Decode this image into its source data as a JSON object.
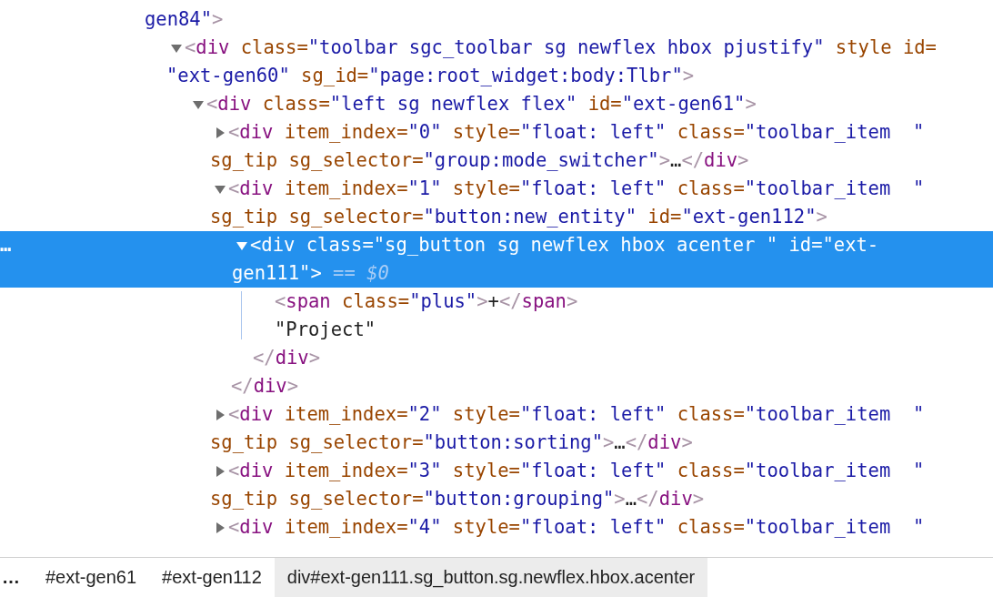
{
  "elements_tree": {
    "top_fragment": [
      {
        "kind": "value",
        "text": "gen84\""
      },
      {
        "kind": "punct",
        "text": ">"
      }
    ],
    "nodes": [
      {
        "kind": "element",
        "expanded": true,
        "selected": false,
        "lines": [
          [
            {
              "kind": "punct",
              "text": "<"
            },
            {
              "kind": "tag",
              "text": "div"
            },
            {
              "kind": "attr",
              "text": " class="
            },
            {
              "kind": "value",
              "text": "\"toolbar sgc_toolbar sg newflex hbox pjustify\""
            },
            {
              "kind": "attr",
              "text": " style id="
            }
          ],
          [
            {
              "kind": "value",
              "text": "\"ext-gen60\""
            },
            {
              "kind": "attr",
              "text": " sg_id="
            },
            {
              "kind": "value",
              "text": "\"page:root_widget:body:Tlbr\""
            },
            {
              "kind": "punct",
              "text": ">"
            }
          ]
        ],
        "children": [
          {
            "kind": "element",
            "expanded": true,
            "selected": false,
            "lines": [
              [
                {
                  "kind": "punct",
                  "text": "<"
                },
                {
                  "kind": "tag",
                  "text": "div"
                },
                {
                  "kind": "attr",
                  "text": " class="
                },
                {
                  "kind": "value",
                  "text": "\"left sg newflex flex\""
                },
                {
                  "kind": "attr",
                  "text": " id="
                },
                {
                  "kind": "value",
                  "text": "\"ext-gen61\""
                },
                {
                  "kind": "punct",
                  "text": ">"
                }
              ]
            ],
            "children": [
              {
                "kind": "element",
                "expanded": false,
                "selected": false,
                "lines": [
                  [
                    {
                      "kind": "punct",
                      "text": "<"
                    },
                    {
                      "kind": "tag",
                      "text": "div"
                    },
                    {
                      "kind": "attr",
                      "text": " item_index="
                    },
                    {
                      "kind": "value",
                      "text": "\"0\""
                    },
                    {
                      "kind": "attr",
                      "text": " style="
                    },
                    {
                      "kind": "value",
                      "text": "\"float: left\""
                    },
                    {
                      "kind": "attr",
                      "text": " class="
                    },
                    {
                      "kind": "value",
                      "text": "\"toolbar_item  \""
                    }
                  ],
                  [
                    {
                      "kind": "attr",
                      "text": "sg_tip sg_selector="
                    },
                    {
                      "kind": "value",
                      "text": "\"group:mode_switcher\""
                    },
                    {
                      "kind": "punct",
                      "text": ">"
                    },
                    {
                      "kind": "text",
                      "text": "…"
                    },
                    {
                      "kind": "punct",
                      "text": "</"
                    },
                    {
                      "kind": "tag",
                      "text": "div"
                    },
                    {
                      "kind": "punct",
                      "text": ">"
                    }
                  ]
                ]
              },
              {
                "kind": "element",
                "expanded": true,
                "selected": false,
                "lines": [
                  [
                    {
                      "kind": "punct",
                      "text": "<"
                    },
                    {
                      "kind": "tag",
                      "text": "div"
                    },
                    {
                      "kind": "attr",
                      "text": " item_index="
                    },
                    {
                      "kind": "value",
                      "text": "\"1\""
                    },
                    {
                      "kind": "attr",
                      "text": " style="
                    },
                    {
                      "kind": "value",
                      "text": "\"float: left\""
                    },
                    {
                      "kind": "attr",
                      "text": " class="
                    },
                    {
                      "kind": "value",
                      "text": "\"toolbar_item  \""
                    }
                  ],
                  [
                    {
                      "kind": "attr",
                      "text": "sg_tip sg_selector="
                    },
                    {
                      "kind": "value",
                      "text": "\"button:new_entity\""
                    },
                    {
                      "kind": "attr",
                      "text": " id="
                    },
                    {
                      "kind": "value",
                      "text": "\"ext-gen112\""
                    },
                    {
                      "kind": "punct",
                      "text": ">"
                    }
                  ]
                ],
                "children": [
                  {
                    "kind": "element",
                    "expanded": true,
                    "selected": true,
                    "gutter": "…",
                    "lines": [
                      [
                        {
                          "kind": "punct",
                          "text": "<"
                        },
                        {
                          "kind": "tag",
                          "text": "div"
                        },
                        {
                          "kind": "attr",
                          "text": " class="
                        },
                        {
                          "kind": "value",
                          "text": "\"sg_button sg newflex hbox acenter \""
                        },
                        {
                          "kind": "attr",
                          "text": " id="
                        },
                        {
                          "kind": "value",
                          "text": "\"ext-"
                        }
                      ],
                      [
                        {
                          "kind": "value",
                          "text": "gen111\""
                        },
                        {
                          "kind": "punct",
                          "text": ">"
                        },
                        {
                          "kind": "ref",
                          "text": " == "
                        },
                        {
                          "kind": "refvar",
                          "text": "$0"
                        }
                      ]
                    ],
                    "children": [
                      {
                        "kind": "leaf",
                        "selected": false,
                        "lines": [
                          [
                            {
                              "kind": "punct",
                              "text": "<"
                            },
                            {
                              "kind": "tag",
                              "text": "span"
                            },
                            {
                              "kind": "attr",
                              "text": " class="
                            },
                            {
                              "kind": "value",
                              "text": "\"plus\""
                            },
                            {
                              "kind": "punct",
                              "text": ">"
                            },
                            {
                              "kind": "text",
                              "text": "+"
                            },
                            {
                              "kind": "punct",
                              "text": "</"
                            },
                            {
                              "kind": "tag",
                              "text": "span"
                            },
                            {
                              "kind": "punct",
                              "text": ">"
                            }
                          ]
                        ]
                      },
                      {
                        "kind": "leaf",
                        "selected": false,
                        "lines": [
                          [
                            {
                              "kind": "text",
                              "text": "\"Project\""
                            }
                          ]
                        ]
                      }
                    ],
                    "closing": [
                      {
                        "kind": "punct",
                        "text": "</"
                      },
                      {
                        "kind": "tag",
                        "text": "div"
                      },
                      {
                        "kind": "punct",
                        "text": ">"
                      }
                    ]
                  }
                ],
                "closing": [
                  {
                    "kind": "punct",
                    "text": "</"
                  },
                  {
                    "kind": "tag",
                    "text": "div"
                  },
                  {
                    "kind": "punct",
                    "text": ">"
                  }
                ]
              },
              {
                "kind": "element",
                "expanded": false,
                "selected": false,
                "lines": [
                  [
                    {
                      "kind": "punct",
                      "text": "<"
                    },
                    {
                      "kind": "tag",
                      "text": "div"
                    },
                    {
                      "kind": "attr",
                      "text": " item_index="
                    },
                    {
                      "kind": "value",
                      "text": "\"2\""
                    },
                    {
                      "kind": "attr",
                      "text": " style="
                    },
                    {
                      "kind": "value",
                      "text": "\"float: left\""
                    },
                    {
                      "kind": "attr",
                      "text": " class="
                    },
                    {
                      "kind": "value",
                      "text": "\"toolbar_item  \""
                    }
                  ],
                  [
                    {
                      "kind": "attr",
                      "text": "sg_tip sg_selector="
                    },
                    {
                      "kind": "value",
                      "text": "\"button:sorting\""
                    },
                    {
                      "kind": "punct",
                      "text": ">"
                    },
                    {
                      "kind": "text",
                      "text": "…"
                    },
                    {
                      "kind": "punct",
                      "text": "</"
                    },
                    {
                      "kind": "tag",
                      "text": "div"
                    },
                    {
                      "kind": "punct",
                      "text": ">"
                    }
                  ]
                ]
              },
              {
                "kind": "element",
                "expanded": false,
                "selected": false,
                "lines": [
                  [
                    {
                      "kind": "punct",
                      "text": "<"
                    },
                    {
                      "kind": "tag",
                      "text": "div"
                    },
                    {
                      "kind": "attr",
                      "text": " item_index="
                    },
                    {
                      "kind": "value",
                      "text": "\"3\""
                    },
                    {
                      "kind": "attr",
                      "text": " style="
                    },
                    {
                      "kind": "value",
                      "text": "\"float: left\""
                    },
                    {
                      "kind": "attr",
                      "text": " class="
                    },
                    {
                      "kind": "value",
                      "text": "\"toolbar_item  \""
                    }
                  ],
                  [
                    {
                      "kind": "attr",
                      "text": "sg_tip sg_selector="
                    },
                    {
                      "kind": "value",
                      "text": "\"button:grouping\""
                    },
                    {
                      "kind": "punct",
                      "text": ">"
                    },
                    {
                      "kind": "text",
                      "text": "…"
                    },
                    {
                      "kind": "punct",
                      "text": "</"
                    },
                    {
                      "kind": "tag",
                      "text": "div"
                    },
                    {
                      "kind": "punct",
                      "text": ">"
                    }
                  ]
                ]
              },
              {
                "kind": "element",
                "expanded": false,
                "selected": false,
                "lines": [
                  [
                    {
                      "kind": "punct",
                      "text": "<"
                    },
                    {
                      "kind": "tag",
                      "text": "div"
                    },
                    {
                      "kind": "attr",
                      "text": " item_index="
                    },
                    {
                      "kind": "value",
                      "text": "\"4\""
                    },
                    {
                      "kind": "attr",
                      "text": " style="
                    },
                    {
                      "kind": "value",
                      "text": "\"float: left\""
                    },
                    {
                      "kind": "attr",
                      "text": " class="
                    },
                    {
                      "kind": "value",
                      "text": "\"toolbar_item  \""
                    }
                  ]
                ]
              }
            ]
          }
        ]
      }
    ]
  },
  "breadcrumbs": [
    {
      "label": "…",
      "selected": false
    },
    {
      "label": "#ext-gen61",
      "selected": false
    },
    {
      "label": "#ext-gen112",
      "selected": false
    },
    {
      "label": "div#ext-gen111.sg_button.sg.newflex.hbox.acenter",
      "selected": true
    }
  ]
}
